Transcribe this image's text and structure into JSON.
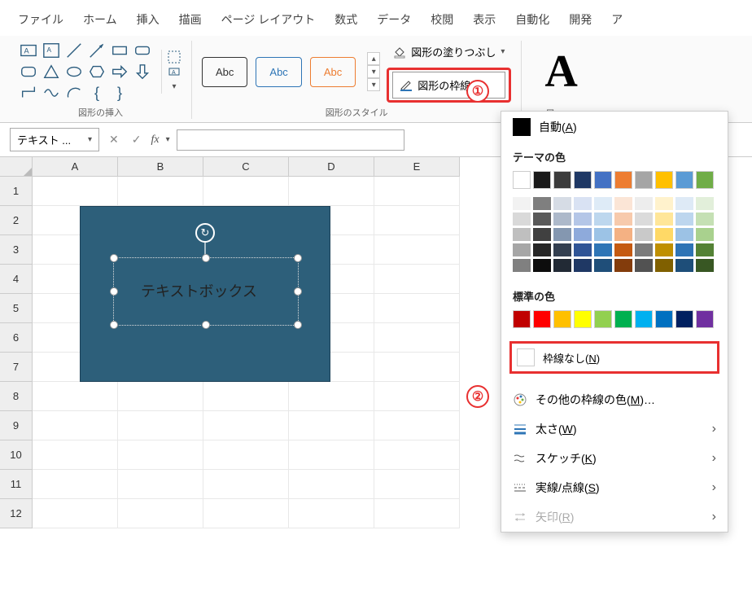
{
  "tabs": {
    "file": "ファイル",
    "home": "ホーム",
    "insert": "挿入",
    "draw": "描画",
    "layout": "ページ レイアウト",
    "formulas": "数式",
    "data": "データ",
    "review": "校閲",
    "view": "表示",
    "automate": "自動化",
    "developer": "開発",
    "more": "ア"
  },
  "ribbon": {
    "shapes_group_label": "図形の挿入",
    "styles_group_label": "図形のスタイル",
    "wordart_group_label_partial": "ワー",
    "style_sample": "Abc",
    "shape_fill_label": "図形の塗りつぶし",
    "shape_outline_label": "図形の枠線",
    "wordart_glyph": "A"
  },
  "formula_bar": {
    "name_box_value": "テキスト ...",
    "fx_label": "fx"
  },
  "grid": {
    "columns": [
      "A",
      "B",
      "C",
      "D",
      "E"
    ],
    "rows": [
      "1",
      "2",
      "3",
      "4",
      "5",
      "6",
      "7",
      "8",
      "9",
      "10",
      "11",
      "12"
    ]
  },
  "canvas": {
    "textbox_text": "テキストボックス"
  },
  "outline_menu": {
    "auto_label": "自動(A)",
    "auto_underline": "A",
    "theme_colors_title": "テーマの色",
    "theme_colors": [
      "#ffffff",
      "#000000",
      "#44546a",
      "#1f3864",
      "#2e75b6",
      "#bf8f00",
      "#548235",
      "#2f5597",
      "#c00000",
      "#7030a0"
    ],
    "theme_color_row1": [
      "#ffffff",
      "#1a1a1a",
      "#3b3b3b",
      "#1f3864",
      "#4472c4",
      "#ed7d31",
      "#a5a5a5",
      "#ffc000",
      "#5b9bd5",
      "#70ad47"
    ],
    "tint_columns": [
      [
        "#f2f2f2",
        "#d9d9d9",
        "#bfbfbf",
        "#a6a6a6",
        "#808080"
      ],
      [
        "#7f7f7f",
        "#595959",
        "#404040",
        "#262626",
        "#0d0d0d"
      ],
      [
        "#d6dce5",
        "#adb9ca",
        "#8497b0",
        "#333f50",
        "#222a35"
      ],
      [
        "#d9e2f3",
        "#b4c6e7",
        "#8eaadb",
        "#2f5496",
        "#1f3864"
      ],
      [
        "#deebf7",
        "#bdd7ee",
        "#9cc3e6",
        "#2e75b6",
        "#1f4e79"
      ],
      [
        "#fbe5d6",
        "#f7caac",
        "#f4b183",
        "#c55a11",
        "#833c0c"
      ],
      [
        "#ededed",
        "#dbdbdb",
        "#c9c9c9",
        "#7b7b7b",
        "#525252"
      ],
      [
        "#fff2cc",
        "#ffe699",
        "#ffd966",
        "#bf8f00",
        "#806000"
      ],
      [
        "#deeaf6",
        "#bdd6ee",
        "#9cc2e5",
        "#2e74b5",
        "#1e4e79"
      ],
      [
        "#e2efda",
        "#c5e0b4",
        "#a9d18e",
        "#548235",
        "#385723"
      ]
    ],
    "standard_colors_title": "標準の色",
    "standard_colors": [
      "#c00000",
      "#ff0000",
      "#ffc000",
      "#ffff00",
      "#92d050",
      "#00b050",
      "#00b0f0",
      "#0070c0",
      "#002060",
      "#7030a0"
    ],
    "no_outline_label": "枠線なし(N)",
    "no_outline_underline": "N",
    "more_colors_label": "その他の枠線の色(M)…",
    "more_colors_underline": "M",
    "weight_label": "太さ(W)",
    "weight_underline": "W",
    "sketch_label": "スケッチ(K)",
    "sketch_underline": "K",
    "dashes_label": "実線/点線(S)",
    "dashes_underline": "S",
    "arrows_label": "矢印(R)",
    "arrows_underline": "R"
  },
  "annotations": {
    "one": "①",
    "two": "②"
  }
}
